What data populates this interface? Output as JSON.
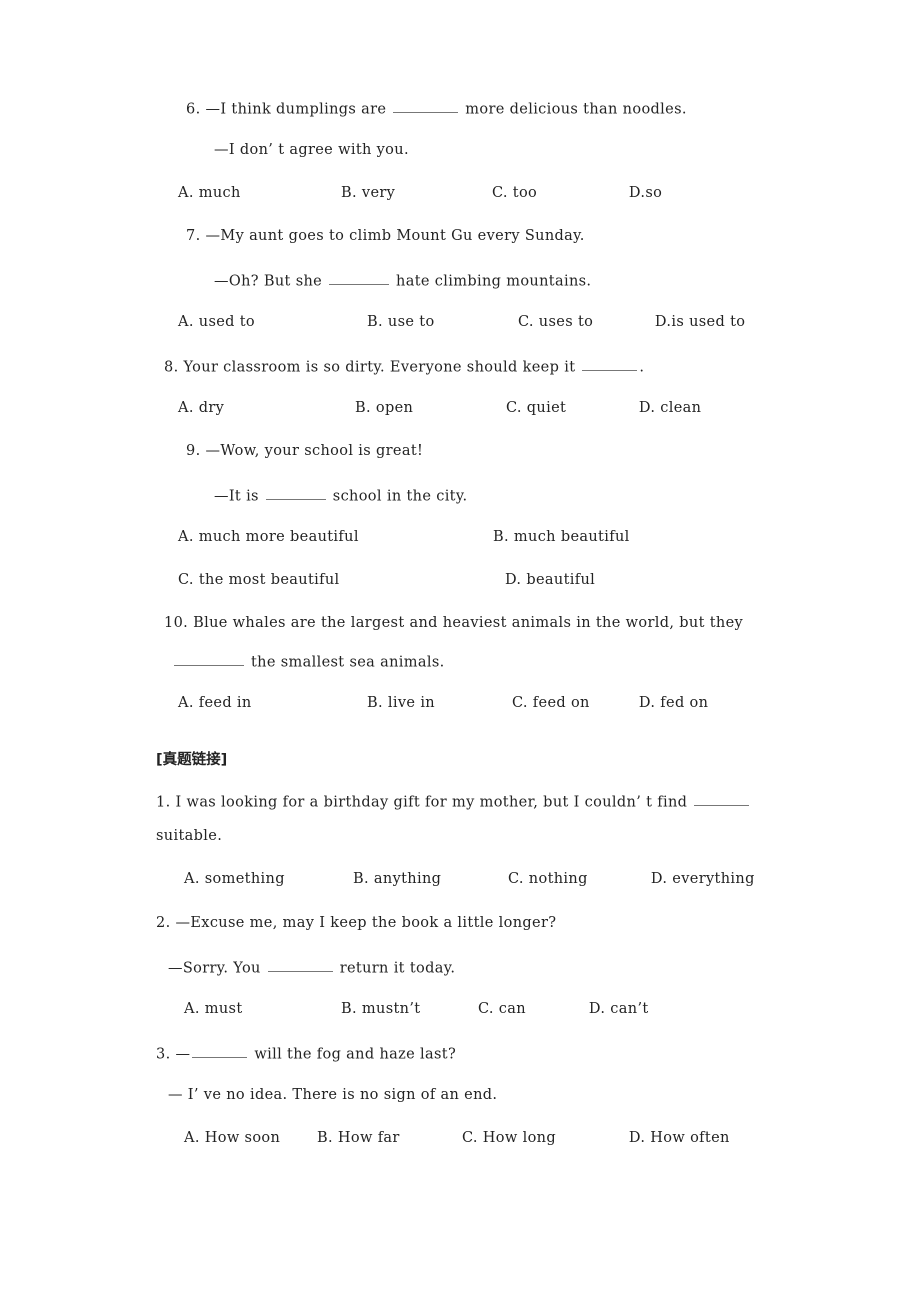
{
  "document": {
    "type": "english-grammar-worksheet",
    "background_color": "#ffffff",
    "text_color": "#232323",
    "rule_color": "#777777"
  },
  "questions": [
    {
      "number": "6.",
      "stem_prefix": "—I think dumplings are",
      "stem_suffix": "more delicious than noodles.",
      "reply": "—I don’ t agree with you.",
      "options": [
        {
          "letter": "A.",
          "text": "much"
        },
        {
          "letter": "B.",
          "text": "very"
        },
        {
          "letter": "C.",
          "text": "too"
        },
        {
          "letter": "D.",
          "text": "so"
        }
      ]
    },
    {
      "number": "7.",
      "stem_prefix": "—My aunt goes to climb Mount Gu every Sunday.",
      "stem_suffix": "",
      "reply_prefix": "—Oh? But she",
      "reply_suffix": "hate climbing mountains.",
      "options": [
        {
          "letter": "A.",
          "text": "used to"
        },
        {
          "letter": "B.",
          "text": "use to"
        },
        {
          "letter": "C.",
          "text": "uses to"
        },
        {
          "letter": "D.",
          "text": "is used to"
        }
      ]
    },
    {
      "number": "8.",
      "stem_prefix": "Your classroom is so dirty. Everyone should keep it",
      "stem_suffix": ".",
      "options": [
        {
          "letter": "A.",
          "text": "dry"
        },
        {
          "letter": "B.",
          "text": "open"
        },
        {
          "letter": "C.",
          "text": "quiet"
        },
        {
          "letter": "D.",
          "text": "clean"
        }
      ]
    },
    {
      "number": "9.",
      "stem_prefix": "—Wow, your school is great!",
      "reply_prefix": "—It is",
      "reply_suffix": "school in the city.",
      "options": [
        {
          "letter": "A.",
          "text": "much more beautiful"
        },
        {
          "letter": "B.",
          "text": "much beautiful"
        },
        {
          "letter": "C.",
          "text": "the most beautiful"
        },
        {
          "letter": "D.",
          "text": "beautiful"
        }
      ]
    },
    {
      "number": "10.",
      "stem_line1": "Blue whales are the largest and heaviest animals in the world, but they",
      "stem_line2_suffix": "the smallest sea animals.",
      "options": [
        {
          "letter": "A.",
          "text": "feed in"
        },
        {
          "letter": "B.",
          "text": "live in"
        },
        {
          "letter": "C.",
          "text": "feed on"
        },
        {
          "letter": "D.",
          "text": "fed on"
        }
      ]
    }
  ],
  "section": {
    "heading": "[真题链接]",
    "questions": [
      {
        "number": "1.",
        "stem_line1": "I was looking for a birthday gift for my mother, but I couldn’ t find",
        "stem_line2": "suitable.",
        "options": [
          {
            "letter": "A.",
            "text": "something"
          },
          {
            "letter": "B.",
            "text": "anything"
          },
          {
            "letter": "C.",
            "text": "nothing"
          },
          {
            "letter": "D.",
            "text": "everything"
          }
        ]
      },
      {
        "number": "2.",
        "stem_prefix": "—Excuse me, may I keep the book a little longer?",
        "reply_prefix": "—Sorry. You",
        "reply_suffix": "return it today.",
        "options": [
          {
            "letter": "A.",
            "text": "must"
          },
          {
            "letter": "B.",
            "text": "mustn’t"
          },
          {
            "letter": "C.",
            "text": "can"
          },
          {
            "letter": "D.",
            "text": "can’t"
          }
        ]
      },
      {
        "number": "3.",
        "stem_prefix": "—",
        "stem_suffix": "will the fog and haze last?",
        "reply": "— I’ ve no idea. There is no sign of an end.",
        "options": [
          {
            "letter": "A.",
            "text": "How soon"
          },
          {
            "letter": "B.",
            "text": "How far"
          },
          {
            "letter": "C.",
            "text": "How long"
          },
          {
            "letter": "D.",
            "text": "How often"
          }
        ]
      }
    ]
  }
}
